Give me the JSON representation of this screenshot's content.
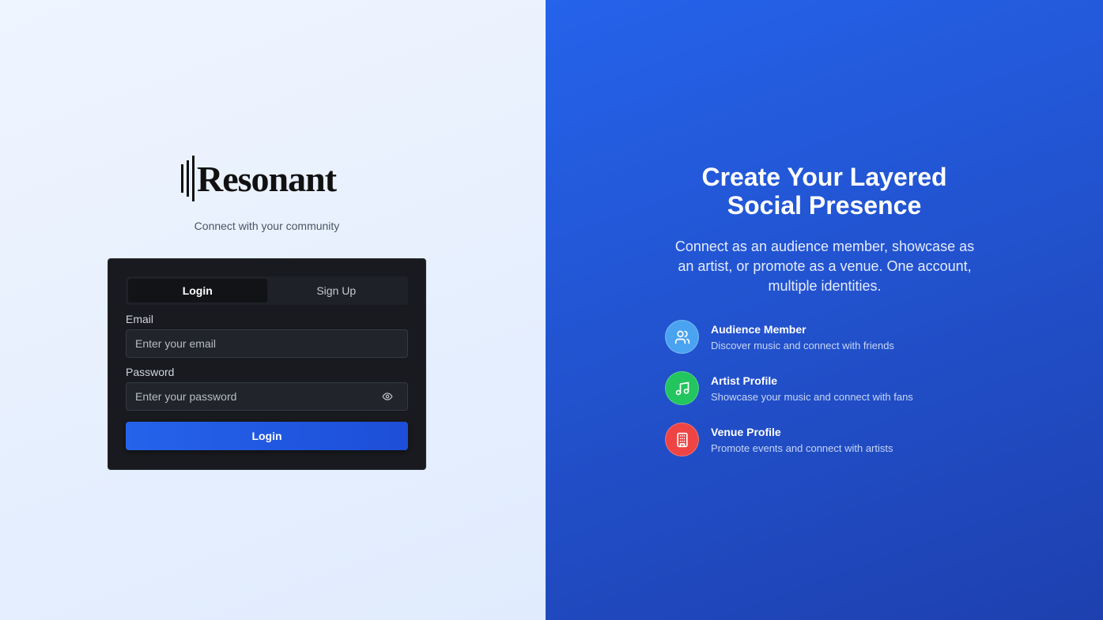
{
  "brand": {
    "name": "Resonant",
    "tagline": "Connect with your community"
  },
  "auth": {
    "tabs": [
      {
        "label": "Login",
        "active": true
      },
      {
        "label": "Sign Up",
        "active": false
      }
    ],
    "email_label": "Email",
    "email_placeholder": "Enter your email",
    "password_label": "Password",
    "password_placeholder": "Enter your password",
    "show_password_icon": "eye-icon",
    "submit_label": "Login"
  },
  "promo": {
    "headline_line1": "Create Your Layered",
    "headline_line2": "Social Presence",
    "subheadline": "Connect as an audience member, showcase as an artist, or promote as a venue. One account, multiple identities.",
    "features": [
      {
        "title": "Audience Member",
        "description": "Discover music and connect with friends",
        "icon": "users-icon",
        "color": "#4aa3f0"
      },
      {
        "title": "Artist Profile",
        "description": "Showcase your music and connect with fans",
        "icon": "music-note-icon",
        "color": "#22c55e"
      },
      {
        "title": "Venue Profile",
        "description": "Promote events and connect with artists",
        "icon": "building-icon",
        "color": "#ef4444"
      }
    ]
  },
  "colors": {
    "accent": "#2563eb",
    "card_bg": "#181a1f",
    "left_bg": "#e8f0fe"
  }
}
